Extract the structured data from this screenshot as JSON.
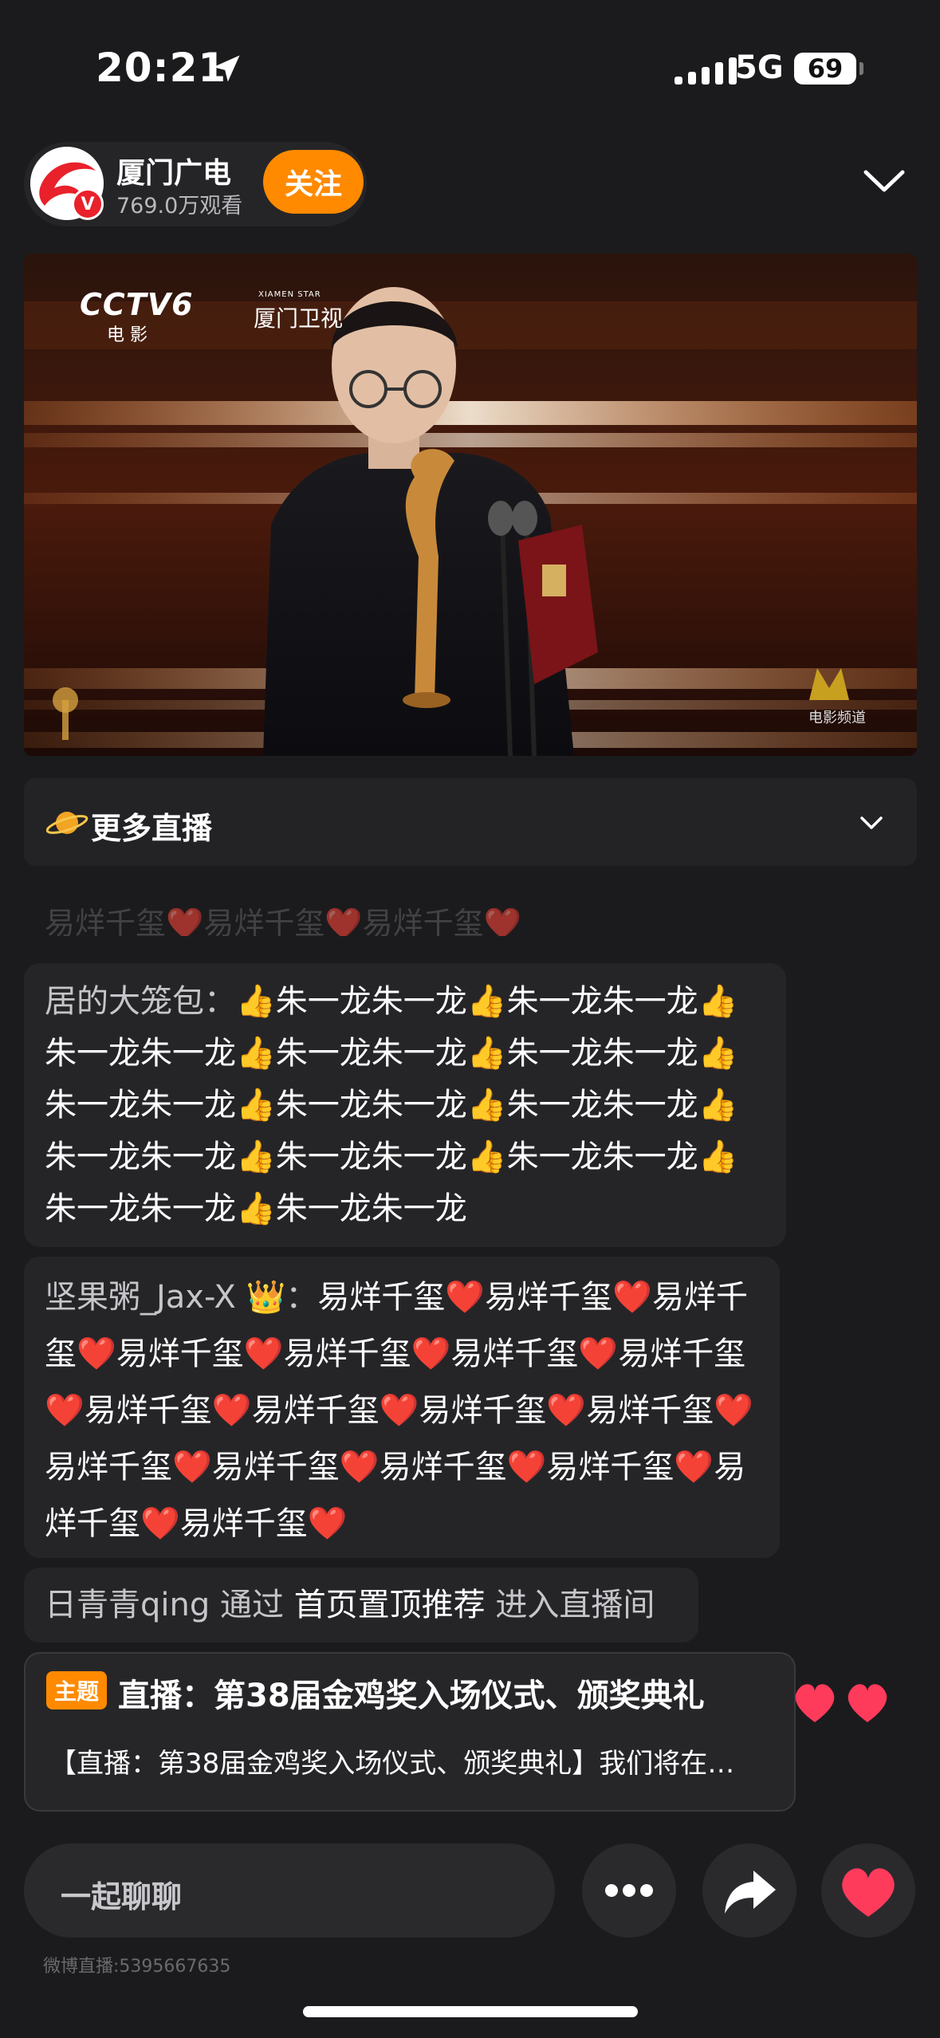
{
  "status_bar": {
    "time": "20:21",
    "network": "5G",
    "battery": "69"
  },
  "header": {
    "channel_name": "厦门广电",
    "viewers": "769.0万观看",
    "follow_label": "关注",
    "verify_mark": "V"
  },
  "video": {
    "logo_cctv": "CCTV6",
    "logo_cctv_sub": "电 影",
    "logo_xiamen": "厦门卫视",
    "logo_xiamen_small": "XIAMEN STAR",
    "movie_channel": "电影频道"
  },
  "more_live": {
    "label": "更多直播"
  },
  "comments": {
    "faded_row": "易烊千玺❤️易烊千玺❤️易烊千玺❤️",
    "c1_user": "居的大笼包：",
    "c1_text": "👍朱一龙朱一龙👍朱一龙朱一龙👍朱一龙朱一龙👍朱一龙朱一龙👍朱一龙朱一龙👍朱一龙朱一龙👍朱一龙朱一龙👍朱一龙朱一龙👍朱一龙朱一龙👍朱一龙朱一龙👍朱一龙朱一龙👍朱一龙朱一龙👍朱一龙朱一龙",
    "c2_user": "坚果粥_Jax-X 👑：",
    "c2_text": "易烊千玺❤️易烊千玺❤️易烊千玺❤️易烊千玺❤️易烊千玺❤️易烊千玺❤️易烊千玺❤️易烊千玺❤️易烊千玺❤️易烊千玺❤️易烊千玺❤️易烊千玺❤️易烊千玺❤️易烊千玺❤️易烊千玺❤️易烊千玺❤️易烊千玺❤️",
    "c3_user": "日青青qing",
    "c3_via": "通过",
    "c3_source": "首页置顶推荐",
    "c3_action": "进入直播间"
  },
  "topic": {
    "tag": "主题",
    "title": "直播：第38届金鸡奖入场仪式、颁奖典礼",
    "desc": "【直播：第38届金鸡奖入场仪式、颁奖典礼】我们将在…"
  },
  "bottom_bar": {
    "chat_placeholder": "一起聊聊",
    "footer_id": "微博直播:5395667635"
  },
  "icons": {
    "location": "location-arrow-icon",
    "collapse": "chevron-down-icon",
    "more": "more-dots-icon",
    "share": "share-arrow-icon",
    "like": "heart-icon",
    "planet": "planet-icon"
  },
  "colors": {
    "accent_orange": "#ff8a00",
    "brand_red": "#e8212b",
    "heart_red": "#ff3b5c"
  }
}
